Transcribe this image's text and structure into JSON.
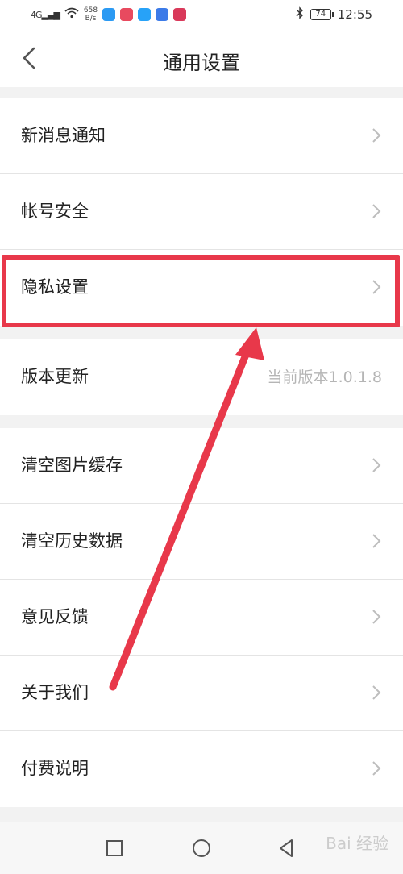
{
  "status_bar": {
    "network": "4G",
    "speed_value": "658",
    "speed_unit": "B/s",
    "battery": "74",
    "time": "12:55"
  },
  "header": {
    "title": "通用设置",
    "back_icon": "chevron-left-icon"
  },
  "group1": {
    "items": [
      {
        "label": "新消息通知"
      },
      {
        "label": "帐号安全"
      },
      {
        "label": "隐私设置"
      }
    ]
  },
  "group2": {
    "items": [
      {
        "label": "版本更新",
        "value": "当前版本1.0.1.8"
      }
    ]
  },
  "group3": {
    "items": [
      {
        "label": "清空图片缓存"
      },
      {
        "label": "清空历史数据"
      },
      {
        "label": "意见反馈"
      },
      {
        "label": "关于我们"
      },
      {
        "label": "付费说明"
      }
    ]
  },
  "system_nav": {
    "icons": [
      "square-recent-icon",
      "circle-home-icon",
      "triangle-back-icon"
    ]
  },
  "watermark": "Bai 经验",
  "colors": {
    "highlight": "#e8384a",
    "arrow": "#e8384a",
    "background": "#f2f2f2"
  }
}
